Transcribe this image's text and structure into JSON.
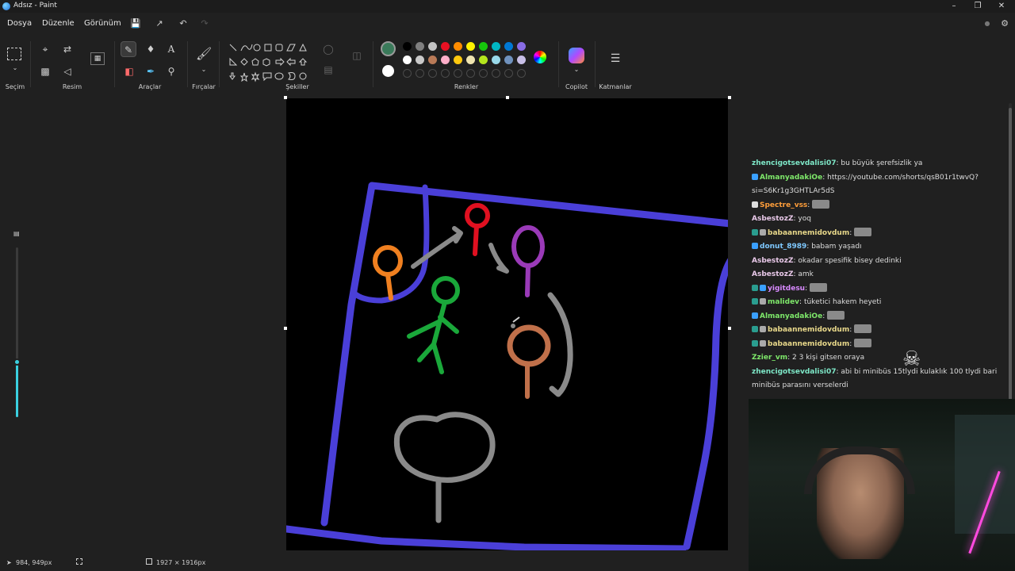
{
  "window": {
    "title": "Adsız - Paint"
  },
  "menu": {
    "items": [
      "Dosya",
      "Düzenle",
      "Görünüm"
    ]
  },
  "ribbon": {
    "groups": {
      "selection": "Seçim",
      "image": "Resim",
      "tools": "Araçlar",
      "brushes": "Fırçalar",
      "shapes": "Şekiller",
      "colors": "Renkler",
      "copilot": "Copilot",
      "layers": "Katmanlar"
    },
    "palette_row1": [
      "#000000",
      "#7f7f7f",
      "#c3c3c3",
      "#e81123",
      "#ff8c00",
      "#fff100",
      "#16c60c",
      "#00b7c3",
      "#0078d4",
      "#886ce4"
    ],
    "palette_row2": [
      "#ffffff",
      "#c8c8c8",
      "#b97a57",
      "#ffaec9",
      "#ffc90e",
      "#efe4b0",
      "#b5e61d",
      "#99d9ea",
      "#7092be",
      "#c8bfe7"
    ],
    "primary_color": "#3a7a5a",
    "secondary_color": "#ffffff"
  },
  "status": {
    "cursor_pos": "984, 949px",
    "canvas_size": "1927 × 1916px"
  },
  "chat": [
    {
      "user": "zhencigotsevdalisi07",
      "color": "#7ee8c8",
      "badges": [],
      "text": "bu büyük şerefsizlik ya"
    },
    {
      "user": "AlmanyadakiOe",
      "color": "#7ee86a",
      "badges": [
        "#3aa0ff"
      ],
      "text": "https://youtube.com/shorts/qsB01r1twvQ?si=S6Kr1g3GHTLAr5dS"
    },
    {
      "user": "Spectre_vss",
      "color": "#ff9e3a",
      "badges": [
        "#dddddd"
      ],
      "text": "",
      "emote": true
    },
    {
      "user": "AsbestozZ",
      "color": "#e8c8e8",
      "badges": [],
      "text": "yoq"
    },
    {
      "user": "babaannemidovdum",
      "color": "#e8d88a",
      "badges": [
        "#2a9d8f",
        "#aaaaaa"
      ],
      "text": "",
      "emote": true
    },
    {
      "user": "donut_8989",
      "color": "#7ec8ff",
      "badges": [
        "#3aa0ff"
      ],
      "text": "babam yaşadı"
    },
    {
      "user": "AsbestozZ",
      "color": "#e8c8e8",
      "badges": [],
      "text": "okadar spesifik bisey dedinki"
    },
    {
      "user": "AsbestozZ",
      "color": "#e8c8e8",
      "badges": [],
      "text": "amk"
    },
    {
      "user": "yigitdesu",
      "color": "#d88aff",
      "badges": [
        "#2a9d8f",
        "#3aa0ff"
      ],
      "text": "",
      "emote": true
    },
    {
      "user": "malidev",
      "color": "#7ee86a",
      "badges": [
        "#2a9d8f",
        "#aaaaaa"
      ],
      "text": "tüketici hakem heyeti"
    },
    {
      "user": "AlmanyadakiOe",
      "color": "#7ee86a",
      "badges": [
        "#3aa0ff"
      ],
      "text": "",
      "emote": true
    },
    {
      "user": "babaannemidovdum",
      "color": "#e8d88a",
      "badges": [
        "#2a9d8f",
        "#aaaaaa"
      ],
      "text": "",
      "emote": true
    },
    {
      "user": "babaannemidovdum",
      "color": "#e8d88a",
      "badges": [
        "#2a9d8f",
        "#aaaaaa"
      ],
      "text": "",
      "emote": true
    },
    {
      "user": "Zzier_vm",
      "color": "#7ee86a",
      "badges": [],
      "text": "2 3 kişi gitsen oraya"
    },
    {
      "user": "zhencigotsevdalisi07",
      "color": "#7ee8c8",
      "badges": [],
      "text": "abi bi minibüs 15tlydi kulaklık 100 tlydi bari minibüs parasını verselerdi"
    }
  ]
}
